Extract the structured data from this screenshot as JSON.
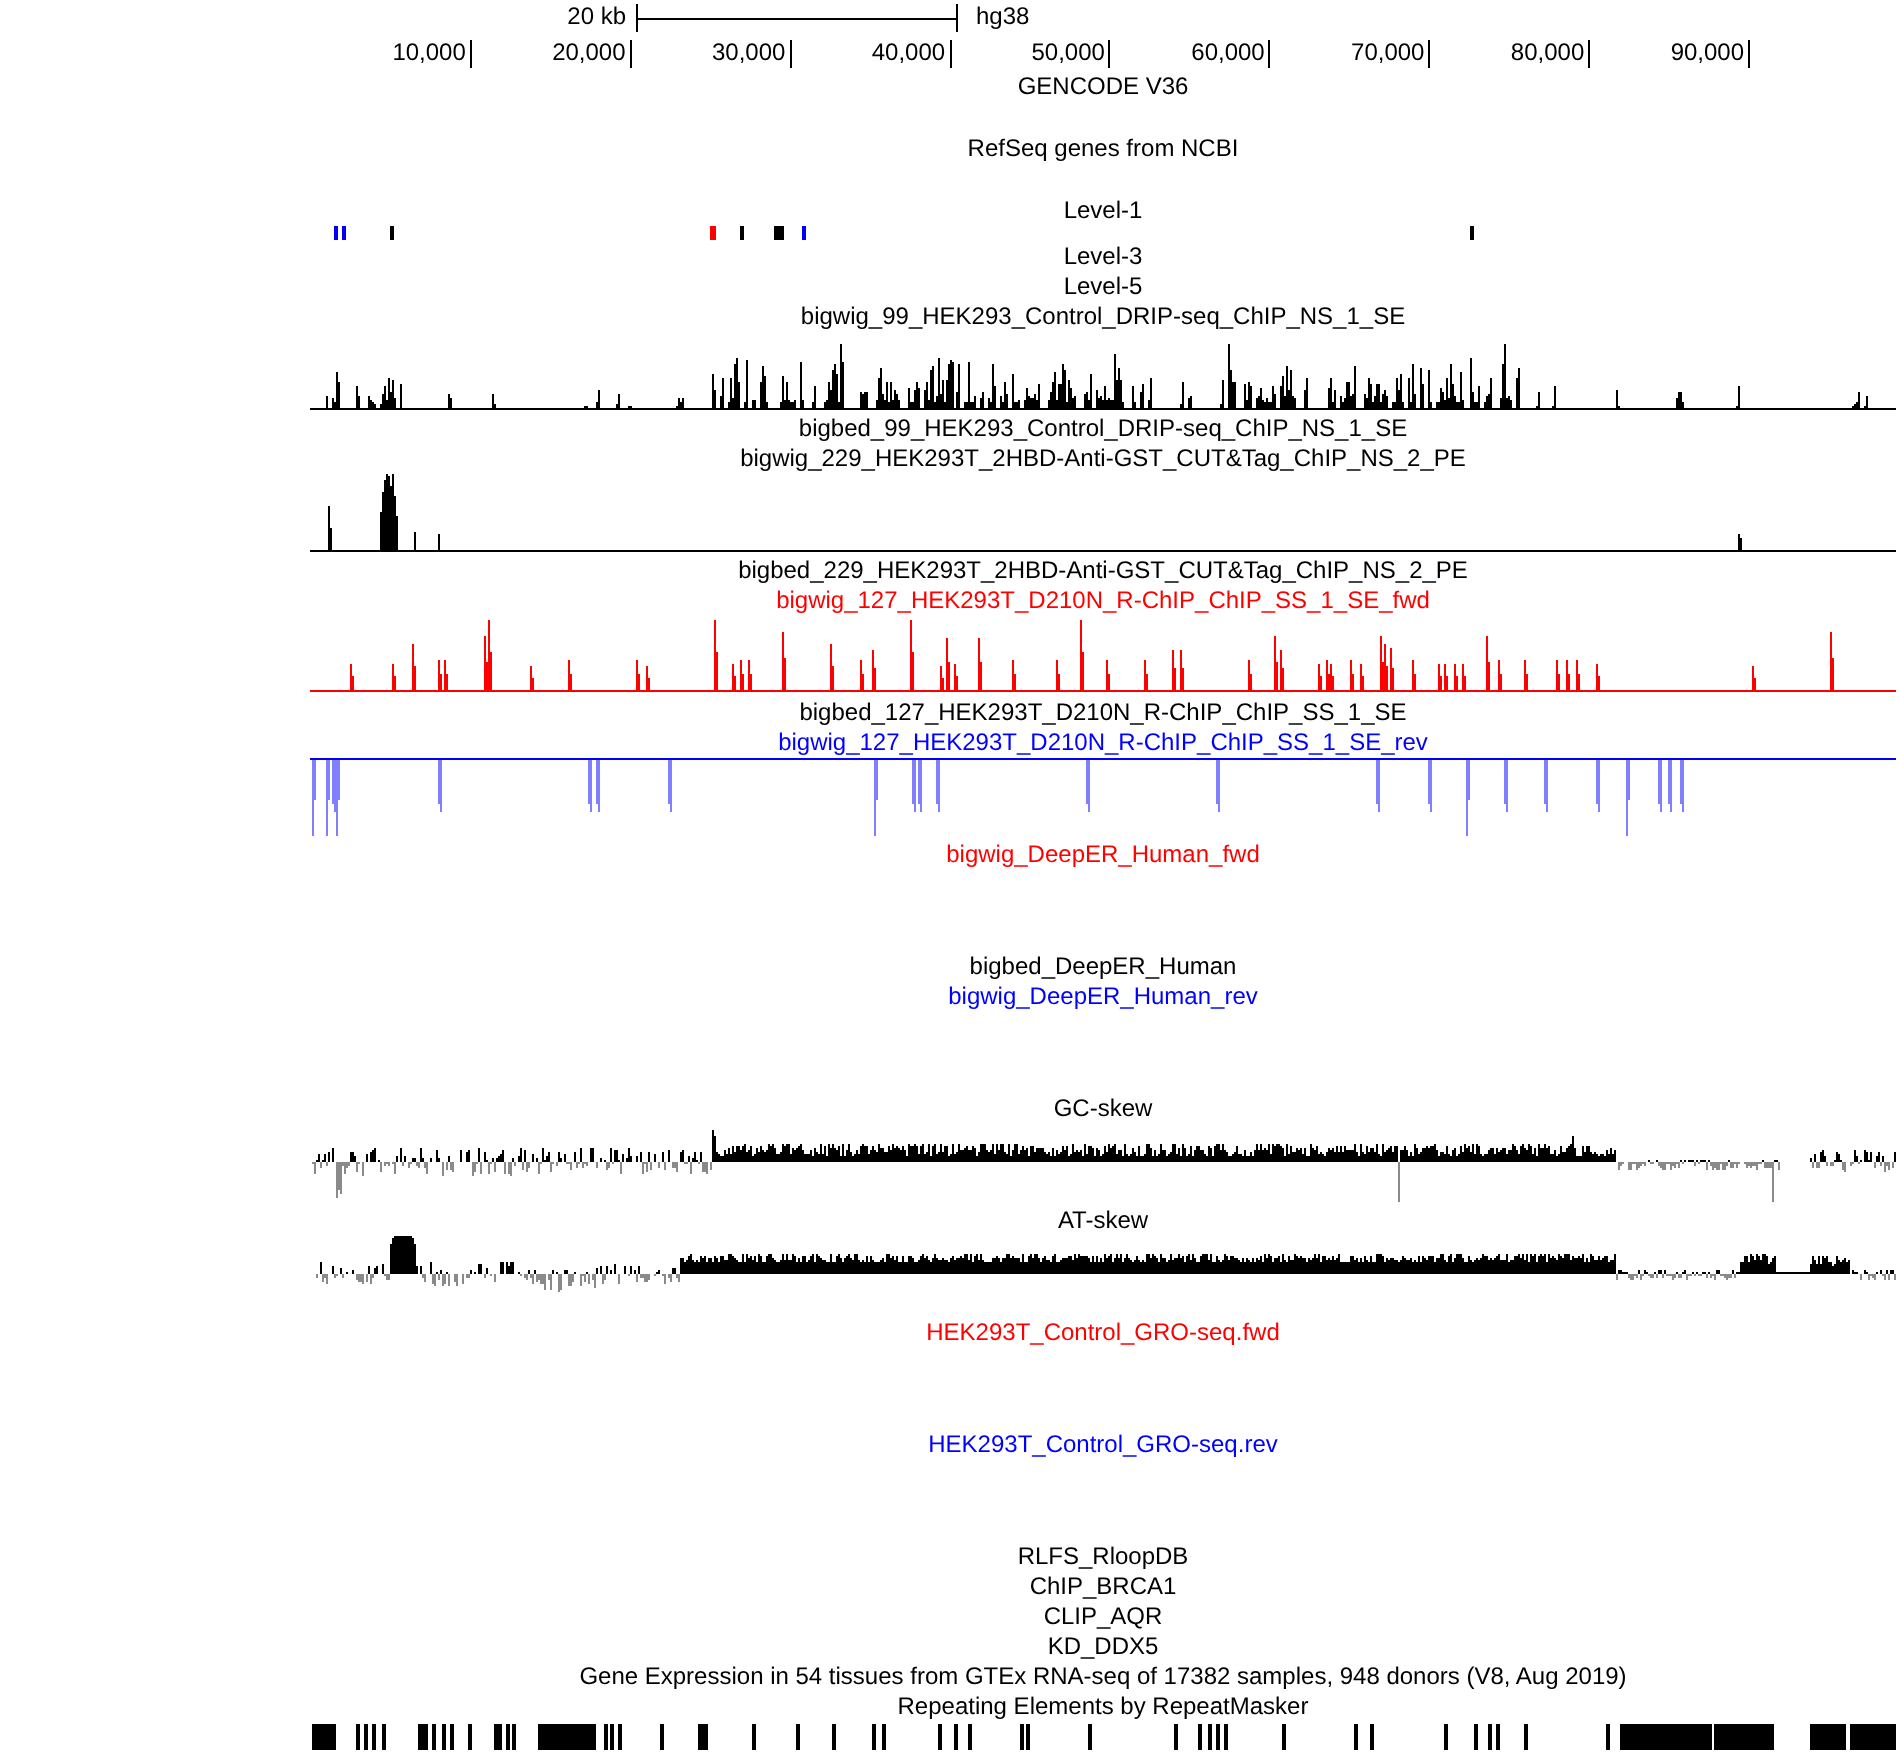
{
  "ruler": {
    "scale": "20 kb",
    "assembly": "hg38",
    "positions": [
      "10,000",
      "20,000",
      "30,000",
      "40,000",
      "50,000",
      "60,000",
      "70,000",
      "80,000",
      "90,000"
    ]
  },
  "tracks": [
    {
      "kind": "genes",
      "title": "GENCODE V36",
      "color": "#000000"
    },
    {
      "kind": "genes",
      "title": "RefSeq genes from NCBI",
      "color": "#000000"
    },
    {
      "kind": "genes",
      "title": "Level-1",
      "color": "#000000",
      "features": [
        {
          "color": "#0000ff"
        },
        {
          "color": "#0000ff"
        },
        {
          "color": "#000000"
        },
        {
          "color": "#ff0000"
        },
        {
          "color": "#000000"
        },
        {
          "color": "#000000"
        },
        {
          "color": "#0000ff"
        },
        {
          "color": "#000000"
        }
      ]
    },
    {
      "kind": "label",
      "title": "Level-3",
      "color": "#000000"
    },
    {
      "kind": "label",
      "title": "Level-5",
      "color": "#000000"
    },
    {
      "kind": "wiggle",
      "title": "bigwig_99_HEK293_Control_DRIP-seq_ChIP_NS_1_SE",
      "color": "#000000"
    },
    {
      "kind": "label",
      "title": "bigbed_99_HEK293_Control_DRIP-seq_ChIP_NS_1_SE",
      "color": "#000000"
    },
    {
      "kind": "wiggle",
      "title": "bigwig_229_HEK293T_2HBD-Anti-GST_CUT&Tag_ChIP_NS_2_PE",
      "color": "#000000"
    },
    {
      "kind": "label",
      "title": "bigbed_229_HEK293T_2HBD-Anti-GST_CUT&Tag_ChIP_NS_2_PE",
      "color": "#000000"
    },
    {
      "kind": "wiggle",
      "title": "bigwig_127_HEK293T_D210N_R-ChIP_ChIP_SS_1_SE_fwd",
      "color": "#ff0000"
    },
    {
      "kind": "label",
      "title": "bigbed_127_HEK293T_D210N_R-ChIP_ChIP_SS_1_SE",
      "color": "#000000"
    },
    {
      "kind": "wiggle",
      "title": "bigwig_127_HEK293T_D210N_R-ChIP_ChIP_SS_1_SE_rev",
      "color": "#0000ff"
    },
    {
      "kind": "blank",
      "title": "bigwig_DeepER_Human_fwd",
      "color": "#ff0000"
    },
    {
      "kind": "label",
      "title": "bigbed_DeepER_Human",
      "color": "#000000"
    },
    {
      "kind": "blank",
      "title": "bigwig_DeepER_Human_rev",
      "color": "#0000ff"
    },
    {
      "kind": "skew",
      "title": "GC-skew",
      "color": "#000000"
    },
    {
      "kind": "skew",
      "title": "AT-skew",
      "color": "#000000"
    },
    {
      "kind": "blank",
      "title": "HEK293T_Control_GRO-seq.fwd",
      "color": "#ff0000"
    },
    {
      "kind": "blank",
      "title": "HEK293T_Control_GRO-seq.rev",
      "color": "#0000ff"
    },
    {
      "kind": "label",
      "title": "RLFS_RloopDB",
      "color": "#000000"
    },
    {
      "kind": "label",
      "title": "ChIP_BRCA1",
      "color": "#000000"
    },
    {
      "kind": "label",
      "title": "CLIP_AQR",
      "color": "#000000"
    },
    {
      "kind": "label",
      "title": "KD_DDX5",
      "color": "#000000"
    },
    {
      "kind": "label",
      "title": "Gene Expression in 54 tissues from GTEx RNA-seq of 17382 samples, 948 donors (V8, Aug 2019)",
      "color": "#000000"
    },
    {
      "kind": "repeats",
      "title": "Repeating Elements by RepeatMasker",
      "color": "#000000"
    }
  ]
}
